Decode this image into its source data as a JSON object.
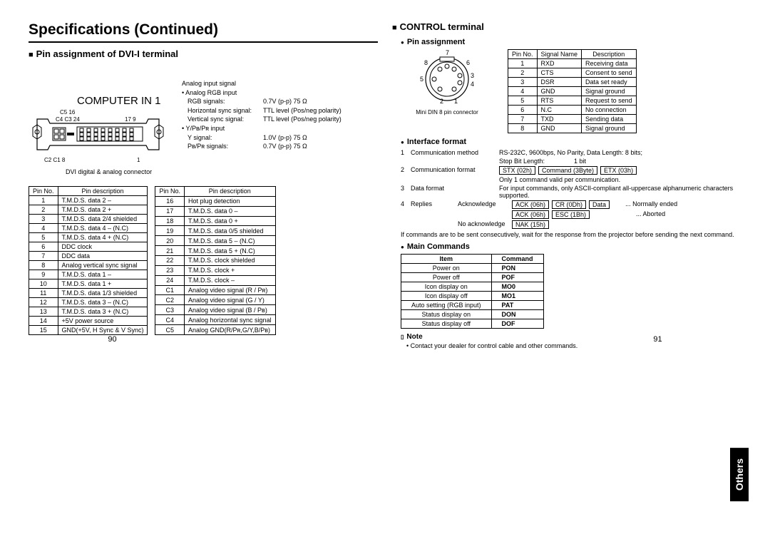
{
  "main_title": "Specifications (Continued)",
  "left": {
    "section": "Pin assignment of DVI-I terminal",
    "computer_in": "COMPUTER IN 1",
    "pin_labels": {
      "c5_16": "C5 16",
      "c4c3_24": "C4 C3 24",
      "p17_9": "17  9",
      "c2c1_8": "C2 C1  8",
      "p1": "1"
    },
    "caption": "DVI digital & analog connector",
    "signals": {
      "header": "Analog input signal",
      "sub": "• Analog RGB input",
      "rows": [
        {
          "name": "RGB signals:",
          "val": "0.7V (p-p) 75 Ω"
        },
        {
          "name": "Horizontal sync signal:",
          "val": "TTL level (Pos/neg polarity)"
        },
        {
          "name": "Vertical sync signal:",
          "val": "TTL level (Pos/neg polarity)"
        }
      ],
      "sub2": "• Y/Pʙ/Pʀ input",
      "rows2": [
        {
          "name": "Y signal:",
          "val": "1.0V (p-p) 75 Ω"
        },
        {
          "name": "Pʙ/Pʀ signals:",
          "val": "0.7V (p-p) 75 Ω"
        }
      ]
    },
    "table_headers": [
      "Pin No.",
      "Pin description"
    ],
    "table1": [
      [
        "1",
        "T.M.D.S. data 2 –"
      ],
      [
        "2",
        "T.M.D.S. data 2 +"
      ],
      [
        "3",
        "T.M.D.S. data 2/4 shielded"
      ],
      [
        "4",
        "T.M.D.S. data 4 – (N.C)"
      ],
      [
        "5",
        "T.M.D.S. data 4 + (N.C)"
      ],
      [
        "6",
        "DDC clock"
      ],
      [
        "7",
        "DDC data"
      ],
      [
        "8",
        "Analog vertical sync signal"
      ],
      [
        "9",
        "T.M.D.S. data 1 –"
      ],
      [
        "10",
        "T.M.D.S. data 1 +"
      ],
      [
        "11",
        "T.M.D.S. data 1/3 shielded"
      ],
      [
        "12",
        "T.M.D.S. data 3 – (N.C)"
      ],
      [
        "13",
        "T.M.D.S. data 3 + (N.C)"
      ],
      [
        "14",
        "+5V power source"
      ],
      [
        "15",
        "GND(+5V, H Sync & V Sync)"
      ]
    ],
    "table2": [
      [
        "16",
        "Hot plug detection"
      ],
      [
        "17",
        "T.M.D.S. data 0 –"
      ],
      [
        "18",
        "T.M.D.S. data 0 +"
      ],
      [
        "19",
        "T.M.D.S. data 0/5 shielded"
      ],
      [
        "20",
        "T.M.D.S. data 5 – (N.C)"
      ],
      [
        "21",
        "T.M.D.S. data 5 + (N.C)"
      ],
      [
        "22",
        "T.M.D.S. clock shielded"
      ],
      [
        "23",
        "T.M.D.S. clock +"
      ],
      [
        "24",
        "T.M.D.S. clock –"
      ],
      [
        "C1",
        "Analog video signal (R / Pʀ)"
      ],
      [
        "C2",
        "Analog video signal (G / Y)"
      ],
      [
        "C3",
        "Analog video signal (B / Pʙ)"
      ],
      [
        "C4",
        "Analog horizontal sync signal"
      ],
      [
        "C5",
        "Analog GND(R/Pʀ,G/Y,B/Pʙ)"
      ]
    ],
    "page": "90"
  },
  "right": {
    "section": "CONTROL terminal",
    "sub_pin": "Pin assignment",
    "din_caption": "Mini DIN 8 pin connector",
    "din_nums": {
      "n1": "1",
      "n2": "2",
      "n3": "3",
      "n4": "4",
      "n5": "5",
      "n6": "6",
      "n7": "7",
      "n8": "8"
    },
    "control_headers": [
      "Pin No.",
      "Signal Name",
      "Description"
    ],
    "control_table": [
      [
        "1",
        "RXD",
        "Receiving data"
      ],
      [
        "2",
        "CTS",
        "Consent to send"
      ],
      [
        "3",
        "DSR",
        "Data set ready"
      ],
      [
        "4",
        "GND",
        "Signal ground"
      ],
      [
        "5",
        "RTS",
        "Request to send"
      ],
      [
        "6",
        "N.C",
        "No connection"
      ],
      [
        "7",
        "TXD",
        "Sending data"
      ],
      [
        "8",
        "GND",
        "Signal ground"
      ]
    ],
    "sub_if": "Interface format",
    "if_rows": {
      "r1": {
        "num": "1",
        "label": "Communication method",
        "desc": "RS-232C, 9600bps, No Parity, Data Length: 8 bits;"
      },
      "r1b": {
        "desc_a": "Stop Bit Length:",
        "desc_b": "1 bit"
      },
      "r2": {
        "num": "2",
        "label": "Communication format",
        "box1": "STX (02h)",
        "box2": "Command (3Byte)",
        "box3": "ETX (03h)"
      },
      "r2b": "Only 1 command valid per communication.",
      "r3": {
        "num": "3",
        "label": "Data format",
        "desc": "For input commands, only ASCII-compliant all-uppercase alphanumeric characters supported."
      },
      "r4": {
        "num": "4",
        "label": "Replies",
        "ack": "Acknowledge",
        "b1": "ACK (06h)",
        "b2": "CR (0Dh)",
        "b3": "Data",
        "tail": "... Normally ended"
      },
      "r4b": {
        "b1": "ACK (06h)",
        "b2": "ESC (1Bh)",
        "tail": "... Aborted"
      },
      "r4c": {
        "label": "No acknowledge",
        "b1": "NAK (15h)"
      }
    },
    "if_note": "If commands are to be sent consecutively, wait for the response from the projector before sending the next command.",
    "sub_cmd": "Main Commands",
    "cmd_headers": [
      "Item",
      "Command"
    ],
    "cmd_table": [
      [
        "Power on",
        "PON"
      ],
      [
        "Power off",
        "POF"
      ],
      [
        "Icon display on",
        "MO0"
      ],
      [
        "Icon display off",
        "MO1"
      ],
      [
        "Auto setting (RGB input)",
        "PAT"
      ],
      [
        "Status display on",
        "DON"
      ],
      [
        "Status display off",
        "DOF"
      ]
    ],
    "note_title": "Note",
    "note_text": "• Contact your dealer for control cable and other commands.",
    "tab": "Others",
    "page": "91"
  }
}
